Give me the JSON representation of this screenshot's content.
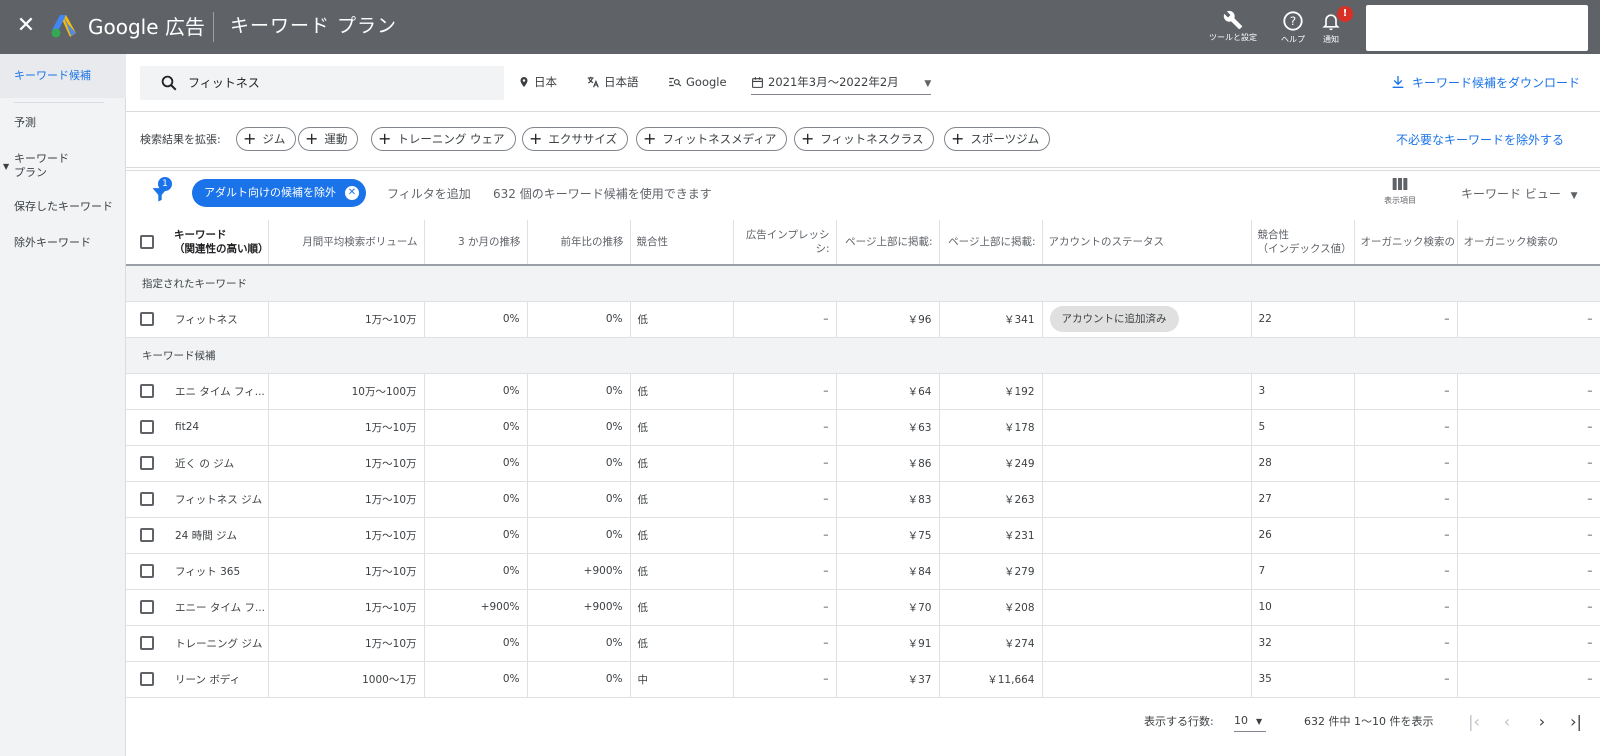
{
  "topbar": {
    "brand": "Google 広告",
    "title": "キーワード プラン",
    "tools_label": "ツールと設定",
    "help_label": "ヘルプ",
    "notifications_label": "通知",
    "notification_badge": "!"
  },
  "sidebar": {
    "items": [
      {
        "label": "キーワード候補",
        "active": true
      },
      {
        "label": "予測"
      },
      {
        "label": "キーワード プラン"
      },
      {
        "label": "保存したキーワード"
      },
      {
        "label": "除外キーワード"
      }
    ]
  },
  "search": {
    "query": "フィットネス",
    "location": "日本",
    "language": "日本語",
    "network": "Google",
    "date_range": "2021年3月～2022年2月",
    "download_label": "キーワード候補をダウンロード"
  },
  "expand": {
    "label": "検索結果を拡張:",
    "chips": [
      "ジム",
      "運動",
      "トレーニング ウェア",
      "エクササイズ",
      "フィットネスメディア",
      "フィットネスクラス",
      "スポーツジム"
    ],
    "exclude_link": "不必要なキーワードを除外する"
  },
  "filters": {
    "badge": "1",
    "active_filter": "アダルト向けの候補を除外",
    "add_filter": "フィルタを追加",
    "count_message": "632 個のキーワード候補を使用できます",
    "columns_label": "表示項目",
    "view_label": "キーワード ビュー"
  },
  "table": {
    "headers": {
      "keyword": "キーワード",
      "keyword_sub": "（関連性の高い順）",
      "volume": "月間平均検索ボリューム",
      "three_month": "3 か月の推移",
      "yoy": "前年比の推移",
      "competition": "競合性",
      "impression_share": "広告インプレッシ",
      "impression_share2": "シ:",
      "top_low": "ページ上部に掲載:",
      "top_high": "ページ上部に掲載:",
      "account_status": "アカウントのステータス",
      "comp_index": "競合性",
      "comp_index_sub": "（インデックス値）",
      "organic1": "オーガニック検索の",
      "organic2": "オーガニック検索の"
    },
    "section_provided": "指定されたキーワード",
    "section_ideas": "キーワード候補",
    "provided_rows": [
      {
        "keyword": "フィットネス",
        "volume": "1万～10万",
        "three_month": "0%",
        "yoy": "0%",
        "competition": "低",
        "impression_share": "–",
        "top_low": "￥96",
        "top_high": "￥341",
        "status": "アカウントに追加済み",
        "comp_index": "22",
        "organic1": "–",
        "organic2": "–"
      }
    ],
    "idea_rows": [
      {
        "keyword": "エニ タイム フィ...",
        "volume": "10万～100万",
        "three_month": "0%",
        "yoy": "0%",
        "competition": "低",
        "impression_share": "–",
        "top_low": "￥64",
        "top_high": "￥192",
        "status": "",
        "comp_index": "3",
        "organic1": "–",
        "organic2": "–"
      },
      {
        "keyword": "fit24",
        "volume": "1万～10万",
        "three_month": "0%",
        "yoy": "0%",
        "competition": "低",
        "impression_share": "–",
        "top_low": "￥63",
        "top_high": "￥178",
        "status": "",
        "comp_index": "5",
        "organic1": "–",
        "organic2": "–"
      },
      {
        "keyword": "近く の ジム",
        "volume": "1万～10万",
        "three_month": "0%",
        "yoy": "0%",
        "competition": "低",
        "impression_share": "–",
        "top_low": "￥86",
        "top_high": "￥249",
        "status": "",
        "comp_index": "28",
        "organic1": "–",
        "organic2": "–"
      },
      {
        "keyword": "フィットネス ジム",
        "volume": "1万～10万",
        "three_month": "0%",
        "yoy": "0%",
        "competition": "低",
        "impression_share": "–",
        "top_low": "￥83",
        "top_high": "￥263",
        "status": "",
        "comp_index": "27",
        "organic1": "–",
        "organic2": "–"
      },
      {
        "keyword": "24 時間 ジム",
        "volume": "1万～10万",
        "three_month": "0%",
        "yoy": "0%",
        "competition": "低",
        "impression_share": "–",
        "top_low": "￥75",
        "top_high": "￥231",
        "status": "",
        "comp_index": "26",
        "organic1": "–",
        "organic2": "–"
      },
      {
        "keyword": "フィット 365",
        "volume": "1万～10万",
        "three_month": "0%",
        "yoy": "+900%",
        "competition": "低",
        "impression_share": "–",
        "top_low": "￥84",
        "top_high": "￥279",
        "status": "",
        "comp_index": "7",
        "organic1": "–",
        "organic2": "–"
      },
      {
        "keyword": "エニー タイム フ...",
        "volume": "1万～10万",
        "three_month": "+900%",
        "yoy": "+900%",
        "competition": "低",
        "impression_share": "–",
        "top_low": "￥70",
        "top_high": "￥208",
        "status": "",
        "comp_index": "10",
        "organic1": "–",
        "organic2": "–"
      },
      {
        "keyword": "トレーニング ジム",
        "volume": "1万～10万",
        "three_month": "0%",
        "yoy": "0%",
        "competition": "低",
        "impression_share": "–",
        "top_low": "￥91",
        "top_high": "￥274",
        "status": "",
        "comp_index": "32",
        "organic1": "–",
        "organic2": "–"
      },
      {
        "keyword": "リーン ボディ",
        "volume": "1000～1万",
        "three_month": "0%",
        "yoy": "0%",
        "competition": "中",
        "impression_share": "–",
        "top_low": "￥37",
        "top_high": "￥11,664",
        "status": "",
        "comp_index": "35",
        "organic1": "–",
        "organic2": "–"
      }
    ]
  },
  "pager": {
    "rows_label": "表示する行数:",
    "rows_value": "10",
    "range_text": "632 件中 1～10 件を表示"
  },
  "colors": {
    "topbar": "#5f6368",
    "accent": "#1a73e8",
    "badge": "#d93025"
  }
}
